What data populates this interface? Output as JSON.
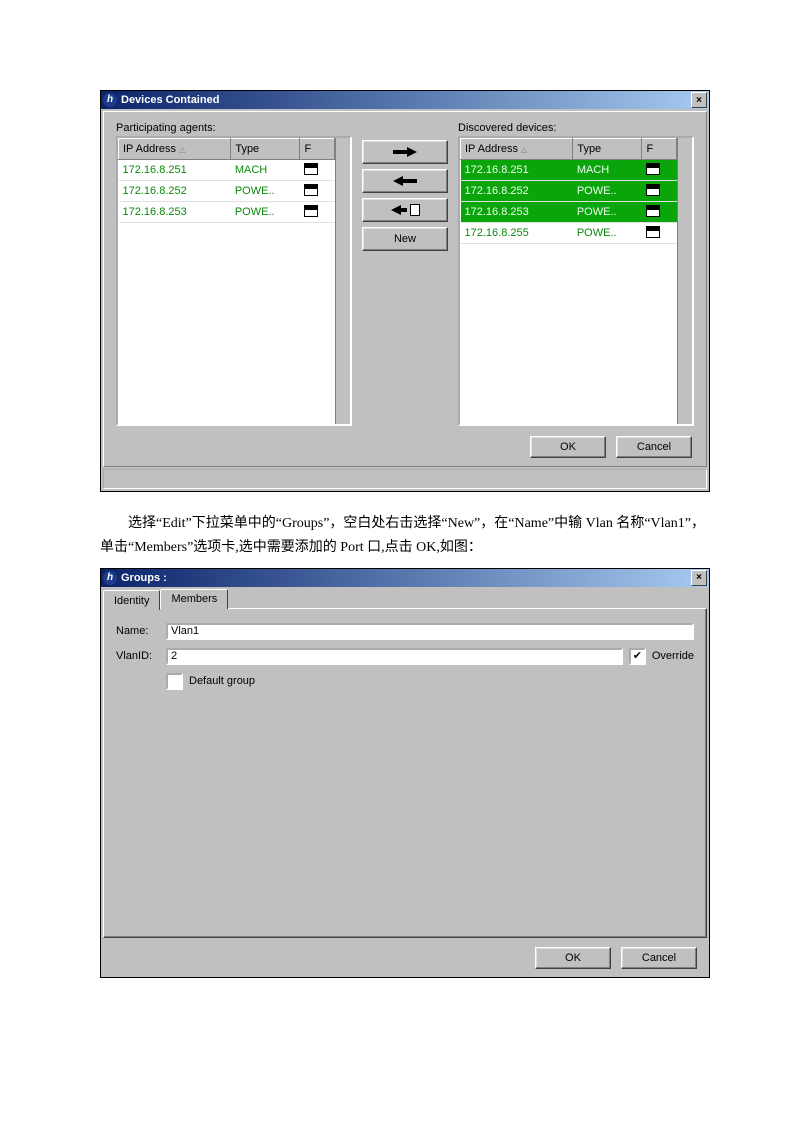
{
  "devices_dialog": {
    "title": "Devices Contained",
    "participating_label": "Participating agents:",
    "discovered_label": "Discovered devices:",
    "headers": {
      "ip": "IP Address",
      "type": "Type",
      "f": "F"
    },
    "participating": [
      {
        "ip": "172.16.8.251",
        "type": "MACH",
        "sel": false
      },
      {
        "ip": "172.16.8.252",
        "type": "POWE..",
        "sel": false
      },
      {
        "ip": "172.16.8.253",
        "type": "POWE..",
        "sel": false
      }
    ],
    "discovered": [
      {
        "ip": "172.16.8.251",
        "type": "MACH",
        "sel": true
      },
      {
        "ip": "172.16.8.252",
        "type": "POWE..",
        "sel": true
      },
      {
        "ip": "172.16.8.253",
        "type": "POWE..",
        "sel": true
      },
      {
        "ip": "172.16.8.255",
        "type": "POWE..",
        "sel": false
      }
    ],
    "new_label": "New",
    "ok_label": "OK",
    "cancel_label": "Cancel"
  },
  "paragraph_text": "选择“Edit”下拉菜单中的“Groups”，空白处右击选择“New”，在“Name”中输 Vlan 名称“Vlan1”，单击“Members”选项卡,选中需要添加的 Port 口,点击 OK,如图：",
  "groups_dialog": {
    "title": "Groups :",
    "tabs": [
      "Identity",
      "Members"
    ],
    "active_tab": 0,
    "name_label": "Name:",
    "name_value": "Vlan1",
    "vlanid_label": "VlanID:",
    "vlanid_value": "2",
    "override_label": "Override",
    "override_checked": true,
    "default_group_label": "Default group",
    "default_group_checked": false,
    "ok_label": "OK",
    "cancel_label": "Cancel"
  }
}
